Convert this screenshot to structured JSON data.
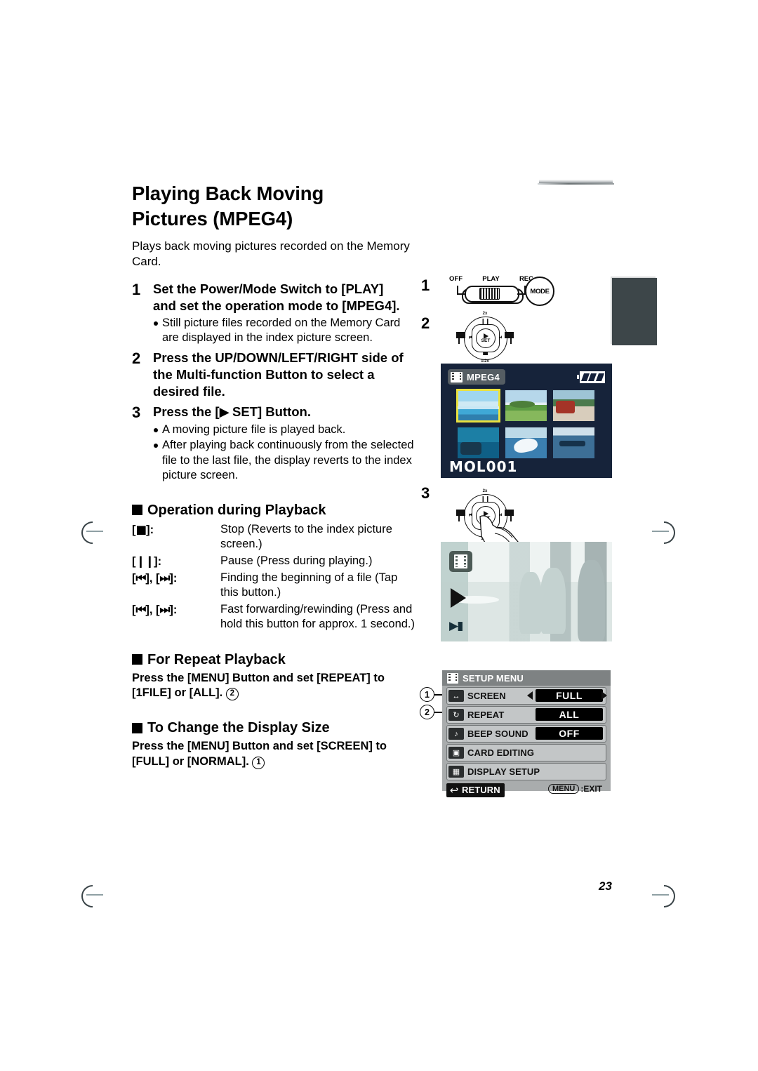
{
  "page": {
    "number": "23"
  },
  "article": {
    "title_line1": "Playing Back Moving",
    "title_line2": "Pictures (MPEG4)",
    "lede": "Plays back moving pictures recorded on the Memory Card."
  },
  "steps": [
    {
      "num": "1",
      "head_line1": "Set the Power/Mode Switch to [PLAY]",
      "head_line2": "and set the operation mode to [MPEG4].",
      "bullets": [
        "Still picture files recorded on the Memory Card are displayed in the index picture screen."
      ]
    },
    {
      "num": "2",
      "head_line1": "Press the UP/DOWN/LEFT/RIGHT side of",
      "head_line2": "the Multi-function Button to select a",
      "head_line3": "desired file.",
      "bullets": []
    },
    {
      "num": "3",
      "head_line1": "Press the [",
      "head_icon": "play-triangle",
      "head_line2": " SET] Button.",
      "bullets": [
        "A moving picture file is played back.",
        "After playing back continuously from the selected file to the last file, the display reverts to the index picture screen."
      ]
    }
  ],
  "operation_section": {
    "heading": "Operation during Playback",
    "rows": [
      {
        "key_prefix": "[",
        "key_icon": "stop-square",
        "key_suffix": "]:",
        "desc": "Stop (Reverts to the index picture screen.)"
      },
      {
        "key_prefix": "[",
        "key_icon": "pause-bars",
        "key_suffix": "]:",
        "desc": "Pause (Press during playing.)"
      },
      {
        "key_prefix": "[",
        "key_icon": "skip-back",
        "key_mid": "], [",
        "key_icon2": "skip-forward",
        "key_suffix": "]:",
        "desc": "Finding the beginning of a file (Tap this button.)"
      },
      {
        "key_prefix": "[",
        "key_icon": "rewind",
        "key_mid": "], [",
        "key_icon2": "fast-forward",
        "key_suffix": "]:",
        "desc": "Fast forwarding/rewinding (Press and hold this button for approx. 1 second.)"
      }
    ]
  },
  "repeat_section": {
    "heading": "For Repeat Playback",
    "instruction_line1": "Press the [MENU] Button and set [REPEAT] to",
    "instruction_line2": "[1FILE] or [ALL].",
    "callout": "2"
  },
  "display_size_section": {
    "heading": "To Change the Display Size",
    "instruction_line1": "Press the [MENU] Button and set [SCREEN] to",
    "instruction_line2": "[FULL] or [NORMAL].",
    "callout": "1"
  },
  "illustrations": {
    "step_labels": {
      "one": "1",
      "two": "2",
      "three": "3"
    },
    "power_switch": {
      "labels": [
        "OFF",
        "PLAY",
        "REC"
      ],
      "mode_button": "MODE"
    },
    "dial": {
      "top_label": "2x",
      "bottom_label": "1/2x",
      "pause_icon": "pause-bars",
      "stop_icon": "stop-square",
      "prev_icon": "skip-back",
      "next_icon": "skip-forward",
      "center_icon": "play-triangle",
      "center_label": "SET"
    },
    "index_screen": {
      "mode_badge": "MPEG4",
      "badge_icon": "film-icon",
      "battery_icon": "battery-full-icon",
      "file_name": "MOL001",
      "thumbnails": [
        {
          "name": "surf-beach",
          "selected": true
        },
        {
          "name": "green-hill",
          "selected": false
        },
        {
          "name": "red-train",
          "selected": false
        },
        {
          "name": "aquarium",
          "selected": false
        },
        {
          "name": "orca-jump",
          "selected": false
        },
        {
          "name": "speed-boat",
          "selected": false
        }
      ],
      "selection_color": "#e9e13f",
      "background_color": "#16233a"
    },
    "playback_screen": {
      "film_icon": "film-icon",
      "play_icon": "play-triangle"
    },
    "setup_menu": {
      "title": "SETUP MENU",
      "title_icon": "film-icon",
      "rows": [
        {
          "icon": "screen-icon",
          "label": "SCREEN",
          "value": "FULL",
          "has_arrows": true,
          "callout": "1"
        },
        {
          "icon": "repeat-icon",
          "label": "REPEAT",
          "value": "ALL",
          "has_arrows": false,
          "callout": "2"
        },
        {
          "icon": "beep-icon",
          "label": "BEEP SOUND",
          "value": "OFF",
          "has_arrows": false,
          "callout": ""
        },
        {
          "icon": "card-icon",
          "label": "CARD EDITING",
          "value": "",
          "has_arrows": false,
          "callout": ""
        },
        {
          "icon": "display-icon",
          "label": "DISPLAY SETUP",
          "value": "",
          "has_arrows": false,
          "callout": ""
        }
      ],
      "return_label": "RETURN",
      "return_icon": "return-arrow-icon",
      "exit_key": "MENU",
      "exit_label": ":EXIT"
    }
  }
}
